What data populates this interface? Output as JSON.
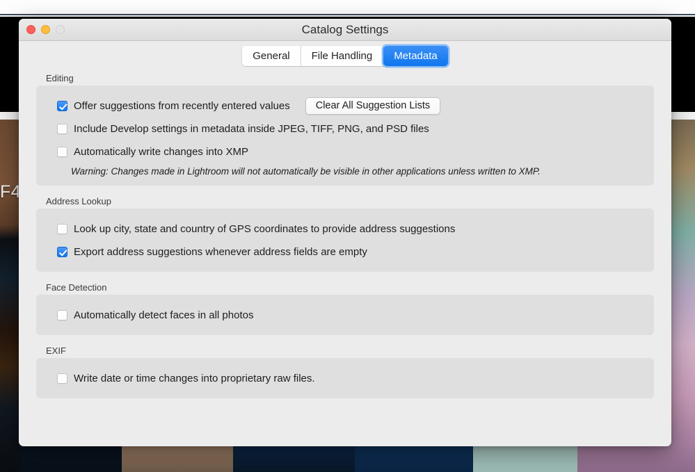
{
  "backdrop": {
    "photo_label": "F4"
  },
  "window": {
    "title": "Catalog Settings",
    "controls": {
      "close": "close",
      "minimize": "minimize",
      "zoom": "zoom"
    }
  },
  "tabs": [
    {
      "label": "General",
      "active": false
    },
    {
      "label": "File Handling",
      "active": false
    },
    {
      "label": "Metadata",
      "active": true
    }
  ],
  "sections": [
    {
      "title": "Editing",
      "rows": [
        {
          "label": "Offer suggestions from recently entered values",
          "checked": true,
          "button": "Clear All Suggestion Lists"
        },
        {
          "label": "Include Develop settings in metadata inside JPEG, TIFF, PNG, and PSD files",
          "checked": false
        },
        {
          "label": "Automatically write changes into XMP",
          "checked": false
        }
      ],
      "note": "Warning: Changes made in Lightroom will not automatically be visible in other applications unless written to XMP."
    },
    {
      "title": "Address Lookup",
      "rows": [
        {
          "label": "Look up city, state and country of GPS coordinates to provide address suggestions",
          "checked": false
        },
        {
          "label": "Export address suggestions whenever address fields are empty",
          "checked": true
        }
      ]
    },
    {
      "title": "Face Detection",
      "rows": [
        {
          "label": "Automatically detect faces in all photos",
          "checked": false
        }
      ]
    },
    {
      "title": "EXIF",
      "rows": [
        {
          "label": "Write date or time changes into proprietary raw files.",
          "checked": false
        }
      ]
    }
  ],
  "colors": {
    "accent_blue": "#1076ee",
    "dialog_bg": "#ececec",
    "panel_bg": "#dfdfdf",
    "close_red": "#fc6058",
    "minimize_yellow": "#fdbc40",
    "zoom_disabled": "#e3e3e3"
  }
}
